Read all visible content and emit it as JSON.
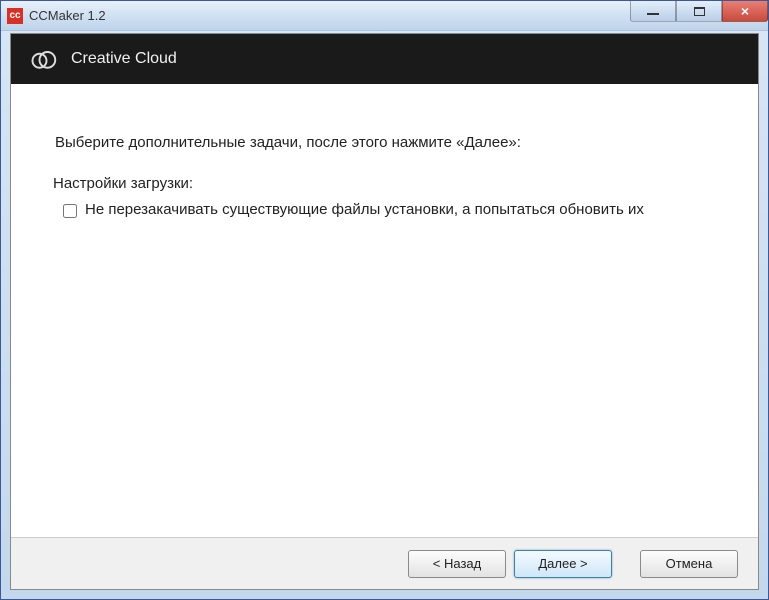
{
  "titlebar": {
    "app_icon_text": "cc",
    "title": "CCMaker 1.2"
  },
  "header": {
    "title": "Creative Cloud"
  },
  "content": {
    "instruction": "Выберите дополнительные задачи, после этого нажмите «Далее»:",
    "section_heading": "Настройки загрузки:",
    "checkbox1_label": "Не перезакачивать существующие файлы установки, а попытаться обновить их",
    "checkbox1_checked": false
  },
  "buttons": {
    "back": "< Назад",
    "next": "Далее >",
    "cancel": "Отмена"
  }
}
